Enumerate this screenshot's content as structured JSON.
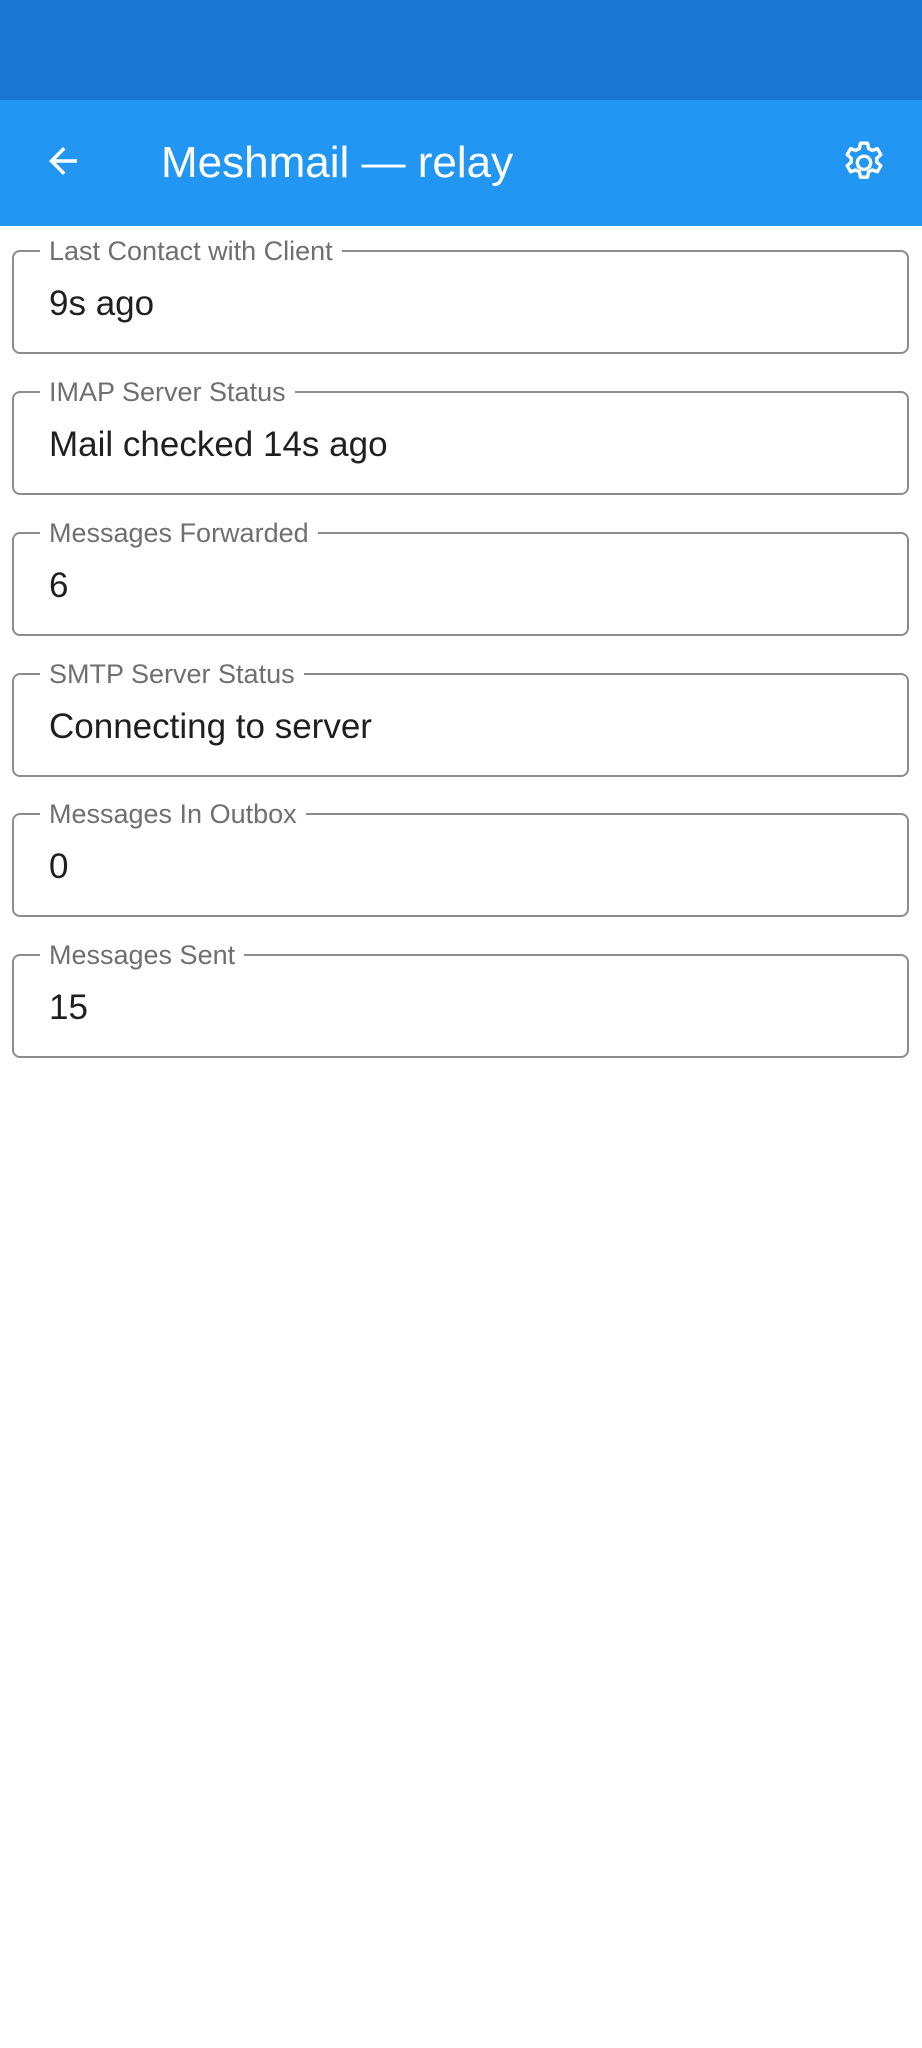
{
  "app_bar": {
    "title": "Meshmail — relay",
    "back_icon": "arrow-left-icon",
    "settings_icon": "gear-icon"
  },
  "colors": {
    "status_bar": "#1976D2",
    "app_bar": "#2196F3",
    "outline": "#8c8c8c",
    "label": "#6f6f6f",
    "value": "#1f1f1f"
  },
  "fields": [
    {
      "label": "Last Contact with Client",
      "value": "9s ago"
    },
    {
      "label": "IMAP Server Status",
      "value": "Mail checked 14s ago"
    },
    {
      "label": "Messages Forwarded",
      "value": "6"
    },
    {
      "label": "SMTP Server Status",
      "value": "Connecting to server"
    },
    {
      "label": "Messages In Outbox",
      "value": "0"
    },
    {
      "label": "Messages Sent",
      "value": "15"
    }
  ]
}
